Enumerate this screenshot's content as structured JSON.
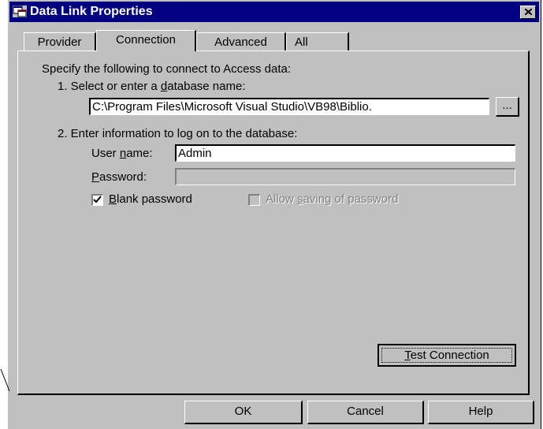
{
  "window": {
    "title": "Data Link Properties"
  },
  "tabs": [
    {
      "label": "Provider"
    },
    {
      "label": "Connection"
    },
    {
      "label": "Advanced"
    },
    {
      "label": "All"
    }
  ],
  "connection": {
    "intro": "Specify the following to connect to Access data:",
    "step1_pre": "1. Select or enter a ",
    "step1_u": "d",
    "step1_post": "atabase name:",
    "database_value": "C:\\Program Files\\Microsoft Visual Studio\\VB98\\Biblio.",
    "browse_label": "...",
    "step2": "2. Enter information to log on to the database:",
    "username_pre": "User ",
    "username_u": "n",
    "username_post": "ame:",
    "username_value": "Admin",
    "password_u": "P",
    "password_post": "assword:",
    "password_value": "",
    "blank_u": "B",
    "blank_post": "lank password",
    "blank_checked": true,
    "allow_pre": "Allow ",
    "allow_u": "s",
    "allow_post": "aving of password",
    "allow_checked": false,
    "test_u": "T",
    "test_post": "est Connection"
  },
  "buttons": {
    "ok": "OK",
    "cancel": "Cancel",
    "help": "Help"
  }
}
